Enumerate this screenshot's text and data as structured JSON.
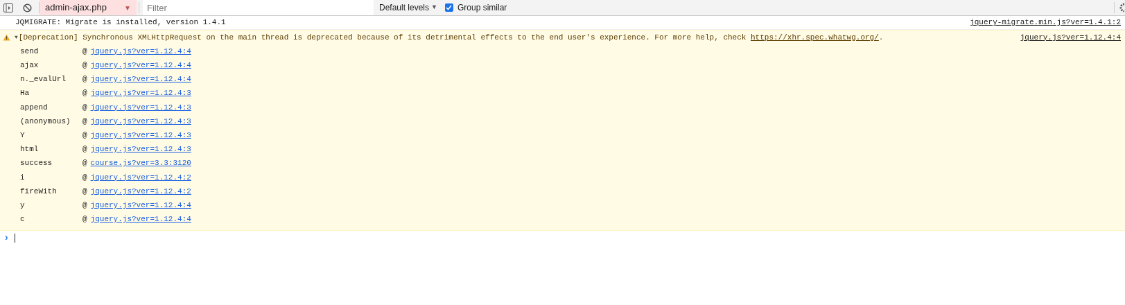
{
  "toolbar": {
    "context": "admin-ajax.php",
    "context_caret": "▼",
    "filter": {
      "placeholder": "Filter"
    },
    "levels": "Default levels",
    "levels_caret": "▼",
    "group_similar": {
      "label": "Group similar",
      "checked": true
    }
  },
  "messages": [
    {
      "kind": "log",
      "text": "JQMIGRATE: Migrate is installed, version 1.4.1",
      "source": "jquery-migrate.min.js?ver=1.4.1:2"
    },
    {
      "kind": "warning",
      "expanded": true,
      "expander": "▼",
      "text_before": "[Deprecation] Synchronous XMLHttpRequest on the main thread is deprecated because of its detrimental effects to the end user's experience. For more help, check ",
      "link": "https://xhr.spec.whatwg.org/",
      "text_after": ".",
      "source": "jquery.js?ver=1.12.4:4",
      "stack": [
        {
          "function": "send",
          "at": "@",
          "location": "jquery.js?ver=1.12.4:4"
        },
        {
          "function": "ajax",
          "at": "@",
          "location": "jquery.js?ver=1.12.4:4"
        },
        {
          "function": "n._evalUrl",
          "at": "@",
          "location": "jquery.js?ver=1.12.4:4"
        },
        {
          "function": "Ha",
          "at": "@",
          "location": "jquery.js?ver=1.12.4:3"
        },
        {
          "function": "append",
          "at": "@",
          "location": "jquery.js?ver=1.12.4:3"
        },
        {
          "function": "(anonymous)",
          "at": "@",
          "location": "jquery.js?ver=1.12.4:3"
        },
        {
          "function": "Y",
          "at": "@",
          "location": "jquery.js?ver=1.12.4:3"
        },
        {
          "function": "html",
          "at": "@",
          "location": "jquery.js?ver=1.12.4:3"
        },
        {
          "function": "success",
          "at": "@",
          "location": "course.js?ver=3.3:3120"
        },
        {
          "function": "i",
          "at": "@",
          "location": "jquery.js?ver=1.12.4:2"
        },
        {
          "function": "fireWith",
          "at": "@",
          "location": "jquery.js?ver=1.12.4:2"
        },
        {
          "function": "y",
          "at": "@",
          "location": "jquery.js?ver=1.12.4:4"
        },
        {
          "function": "c",
          "at": "@",
          "location": "jquery.js?ver=1.12.4:4"
        }
      ]
    }
  ],
  "prompt": {
    "symbol": "›"
  }
}
